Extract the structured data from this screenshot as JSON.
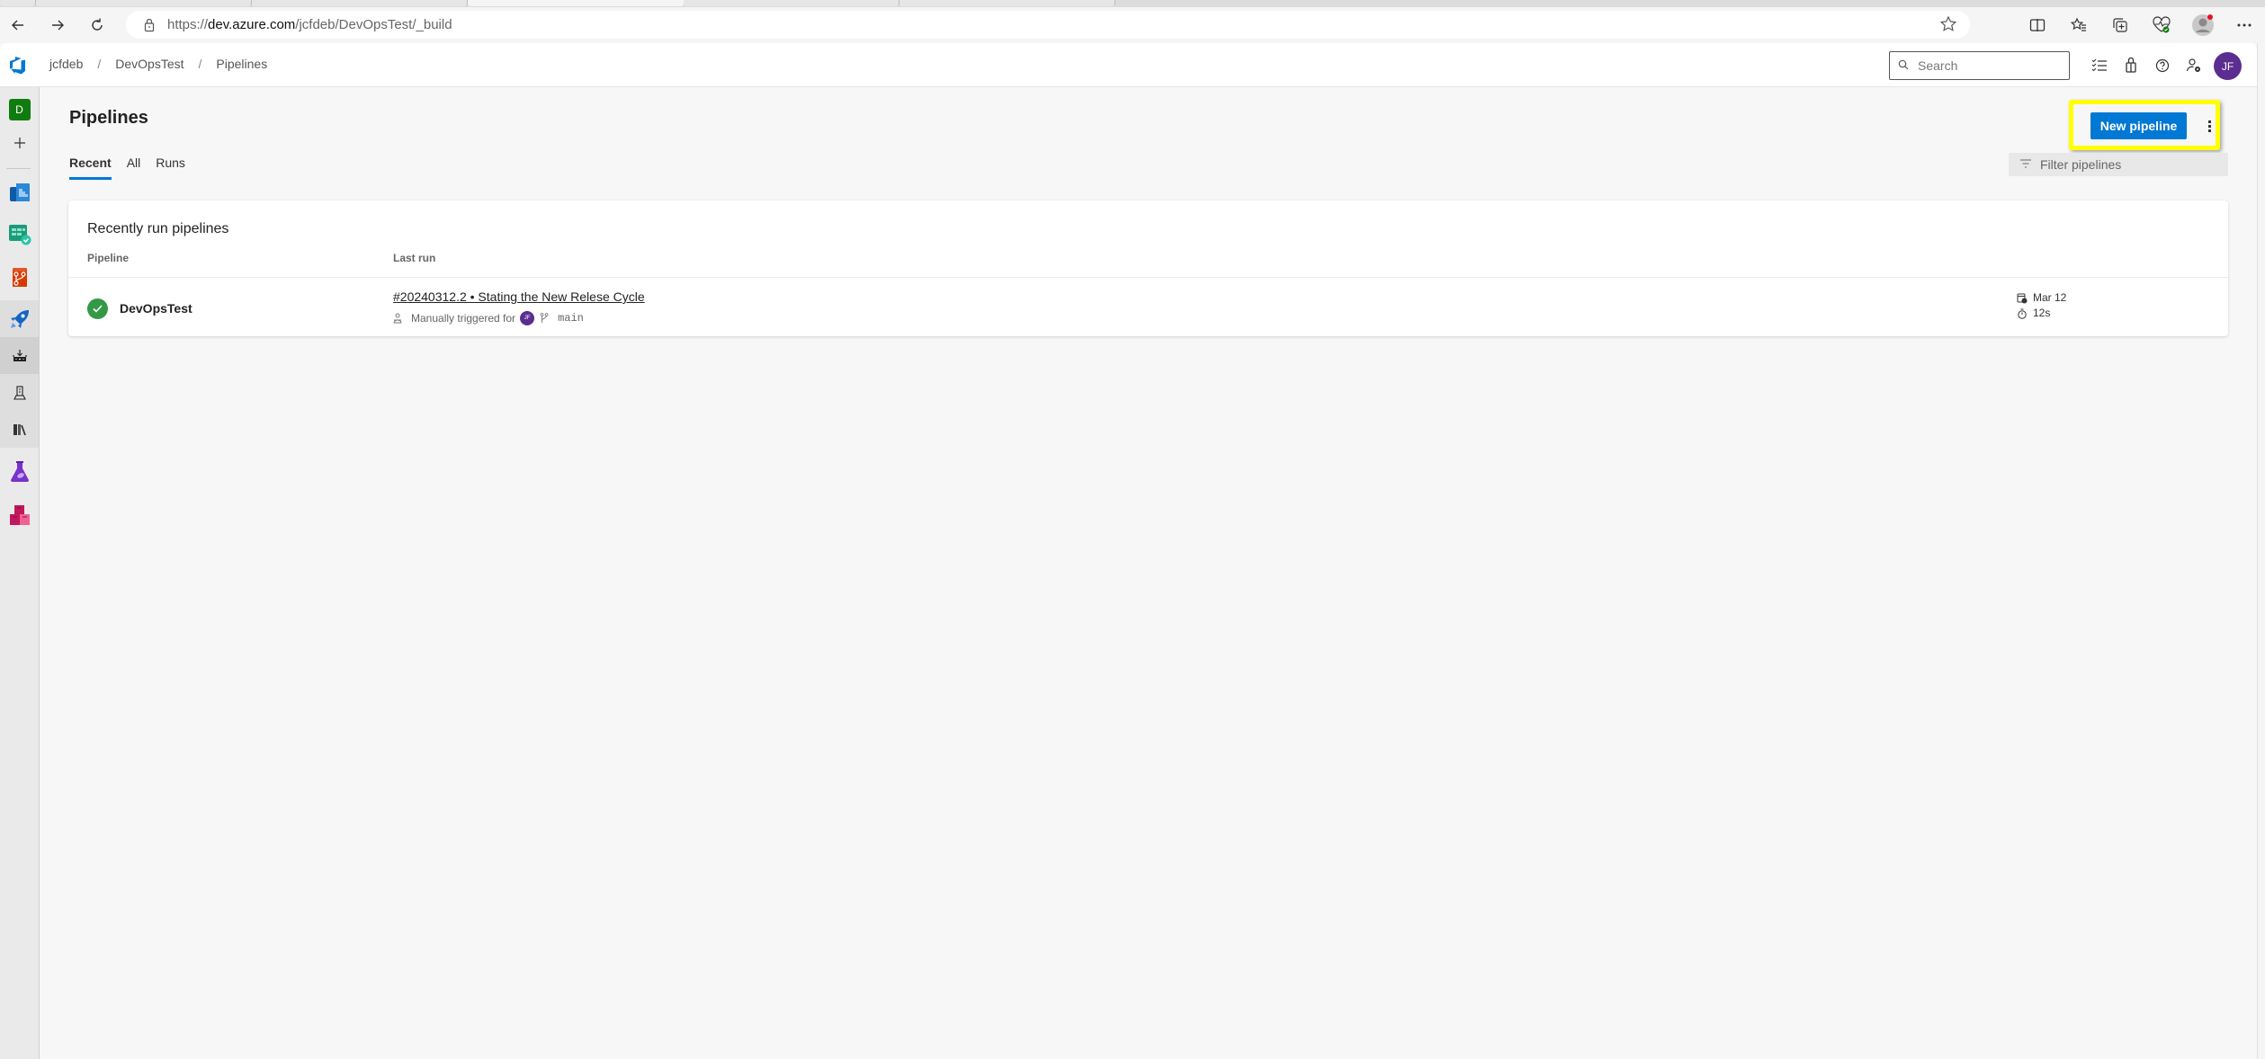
{
  "browser": {
    "url_prefix": "https://",
    "url_domain": "dev.azure.com",
    "url_path": "/jcfdeb/DevOpsTest/_build"
  },
  "header": {
    "breadcrumb": [
      "jcfdeb",
      "DevOpsTest",
      "Pipelines"
    ],
    "search_placeholder": "Search",
    "user_initials": "JF"
  },
  "leftnav": {
    "project_initial": "D",
    "items": [
      {
        "name": "overview",
        "icon": "overview-icon"
      },
      {
        "name": "boards",
        "icon": "boards-icon"
      },
      {
        "name": "repos",
        "icon": "repos-icon"
      },
      {
        "name": "pipelines",
        "icon": "pipelines-icon"
      },
      {
        "name": "pipelines-sub",
        "icon": "pipelines-sub-icon"
      },
      {
        "name": "environments",
        "icon": "environments-icon"
      },
      {
        "name": "library",
        "icon": "library-icon"
      },
      {
        "name": "test-plans",
        "icon": "test-plans-icon"
      },
      {
        "name": "artifacts",
        "icon": "artifacts-icon"
      }
    ]
  },
  "page": {
    "title": "Pipelines",
    "tabs": [
      {
        "label": "Recent",
        "active": true
      },
      {
        "label": "All",
        "active": false
      },
      {
        "label": "Runs",
        "active": false
      }
    ],
    "new_pipeline_label": "New pipeline",
    "filter_placeholder": "Filter pipelines"
  },
  "recent": {
    "title": "Recently run pipelines",
    "columns": [
      "Pipeline",
      "Last run"
    ],
    "rows": [
      {
        "status": "succeeded",
        "pipeline": "DevOpsTest",
        "run_title": "#20240312.2 • Stating the New Relese Cycle",
        "trigger_text": "Manually triggered for",
        "trigger_user_initials": "JF",
        "branch": "main",
        "date": "Mar 12",
        "duration": "12s"
      }
    ]
  },
  "colors": {
    "accent": "#0078d4",
    "success": "#339947",
    "avatar": "#5c2d91",
    "highlight": "#ffff00"
  }
}
